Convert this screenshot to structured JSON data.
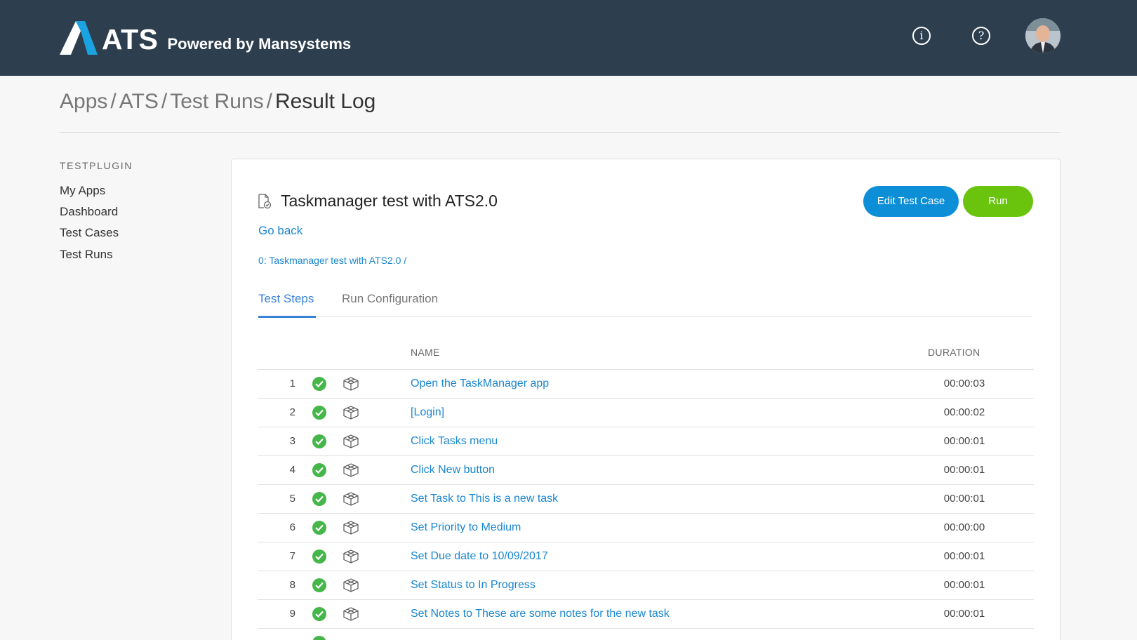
{
  "header": {
    "logo_text": "ATS",
    "logo_sub": "Powered by Mansystems",
    "info_glyph": "i",
    "help_glyph": "?",
    "colors": {
      "bar": "#2d3e4e",
      "logo_accent": "#1aa3e0"
    }
  },
  "breadcrumb": {
    "items": [
      "Apps",
      "ATS",
      "Test Runs"
    ],
    "separator": "/",
    "current": "Result Log"
  },
  "sidebar": {
    "heading": "TESTPLUGIN",
    "items": [
      "My Apps",
      "Dashboard",
      "Test Cases",
      "Test Runs"
    ]
  },
  "main": {
    "title": "Taskmanager test with ATS2.0",
    "edit_button": "Edit Test Case",
    "run_button": "Run",
    "go_back": "Go back",
    "path": "0: Taskmanager test with ATS2.0  /",
    "tabs": [
      "Test Steps",
      "Run Configuration"
    ],
    "active_tab": "Test Steps",
    "columns": {
      "name": "NAME",
      "duration": "DURATION"
    },
    "steps": [
      {
        "num": "1",
        "status": "passed",
        "name": "Open the TaskManager app",
        "duration": "00:00:03"
      },
      {
        "num": "2",
        "status": "passed",
        "name": "[Login]",
        "duration": "00:00:02"
      },
      {
        "num": "3",
        "status": "passed",
        "name": "Click Tasks menu",
        "duration": "00:00:01"
      },
      {
        "num": "4",
        "status": "passed",
        "name": "Click New button",
        "duration": "00:00:01"
      },
      {
        "num": "5",
        "status": "passed",
        "name": "Set Task to This is a new task",
        "duration": "00:00:01"
      },
      {
        "num": "6",
        "status": "passed",
        "name": "Set Priority to Medium",
        "duration": "00:00:00"
      },
      {
        "num": "7",
        "status": "passed",
        "name": "Set Due date to 10/09/2017",
        "duration": "00:00:01"
      },
      {
        "num": "8",
        "status": "passed",
        "name": "Set Status to In Progress",
        "duration": "00:00:01"
      },
      {
        "num": "9",
        "status": "passed",
        "name": "Set Notes to These are some notes for the new task",
        "duration": "00:00:01"
      }
    ],
    "colors": {
      "link": "#1a86d0",
      "edit_button": "#0d8fd8",
      "run_button": "#6ac40e",
      "passed": "#45b649"
    }
  }
}
